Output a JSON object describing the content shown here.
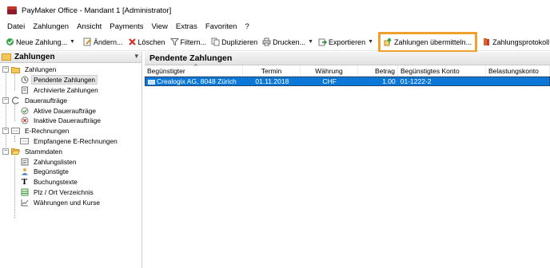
{
  "window": {
    "title": "PayMaker Office - Mandant 1 [Administrator]"
  },
  "menu": [
    "Datei",
    "Zahlungen",
    "Ansicht",
    "Payments",
    "View",
    "Extras",
    "Favoriten",
    "?"
  ],
  "toolbar": {
    "new_payment": "Neue Zahlung...",
    "edit": "Ändern...",
    "delete": "Löschen",
    "filter": "Filtern...",
    "duplicate": "Duplizieren",
    "print": "Drucken...",
    "export": "Exportieren",
    "transmit": "Zahlungen übermitteln...",
    "protocol": "Zahlungsprotokoll"
  },
  "sidebar": {
    "header": "Zahlungen",
    "tree": {
      "zahlungen": "Zahlungen",
      "pendente": "Pendente Zahlungen",
      "archivierte": "Archivierte Zahlungen",
      "dauerauftraege": "Daueraufträge",
      "aktive": "Aktive Daueraufträge",
      "inaktive": "Inaktive Daueraufträge",
      "erechnungen": "E-Rechnungen",
      "empfangene": "Empfangene E-Rechnungen",
      "stammdaten": "Stammdaten",
      "zahlungslisten": "Zahlungslisten",
      "beguenstigte": "Begünstigte",
      "buchungstexte": "Buchungstexte",
      "plz": "Plz / Ort Verzeichnis",
      "waehrungen": "Währungen und Kurse"
    }
  },
  "main": {
    "title": "Pendente Zahlungen",
    "columns": [
      "Begünstigter",
      "Termin",
      "Währung",
      "Betrag",
      "Begünstigtes Konto",
      "Belastungskonto"
    ],
    "rows": [
      {
        "beguenstigter": "Crealogix AG, 8048 Zürich",
        "termin": "01.11.2018",
        "waehrung": "CHF",
        "betrag": "1.00",
        "konto": "01-1222-2",
        "belastungskonto": ""
      }
    ]
  },
  "colors": {
    "selection": "#0b78d7",
    "highlight_frame": "#f0a030"
  }
}
